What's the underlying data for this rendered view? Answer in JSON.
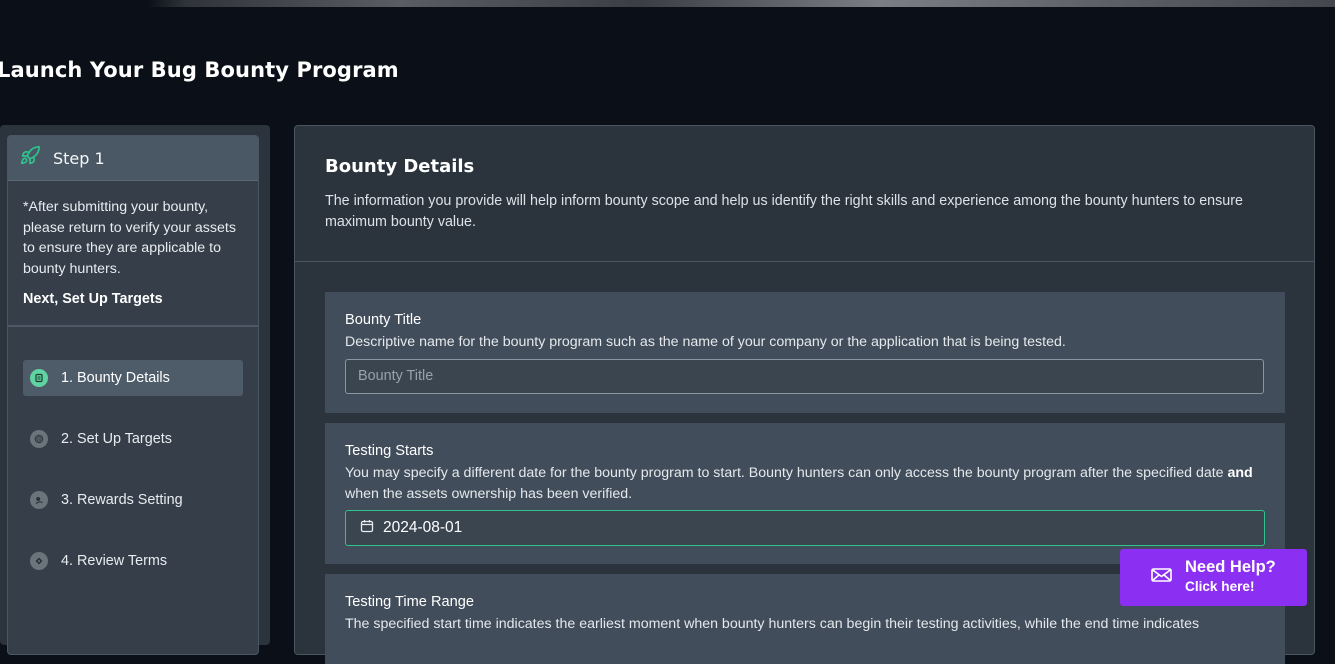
{
  "page": {
    "title": "Launch Your Bug Bounty Program"
  },
  "sidebar": {
    "step_title": "Step 1",
    "note": "*After submitting your bounty, please return to verify your assets to ensure they are applicable to bounty hunters.",
    "next": "Next, Set Up Targets",
    "steps": [
      {
        "label": "1. Bounty Details",
        "icon": "doc-icon",
        "active": true
      },
      {
        "label": "2. Set Up Targets",
        "icon": "target-icon",
        "active": false
      },
      {
        "label": "3. Rewards Setting",
        "icon": "reward-icon",
        "active": false
      },
      {
        "label": "4. Review Terms",
        "icon": "terms-icon",
        "active": false
      }
    ]
  },
  "main": {
    "title": "Bounty Details",
    "description": "The information you provide will help inform bounty scope and help us identify the right skills and experience among the bounty hunters to ensure maximum bounty value.",
    "fields": {
      "title_label": "Bounty Title",
      "title_help": "Descriptive name for the bounty program such as the name of your company or the application that is being tested.",
      "title_placeholder": "Bounty Title",
      "start_label": "Testing Starts",
      "start_help_before": "You may specify a different date for the bounty program to start. Bounty hunters can only access the bounty program after the specified date ",
      "start_help_bold": "and",
      "start_help_after": " when the assets ownership has been verified.",
      "start_value": "2024-08-01",
      "range_label": "Testing Time Range",
      "range_help": "The specified start time indicates the earliest moment when bounty hunters can begin their testing activities, while the end time indicates"
    }
  },
  "help": {
    "title": "Need Help?",
    "subtitle": "Click here!"
  },
  "colors": {
    "accent_green": "#2fc48e",
    "active_dot": "#5fd3a1",
    "help_purple": "#8b2ff2"
  }
}
